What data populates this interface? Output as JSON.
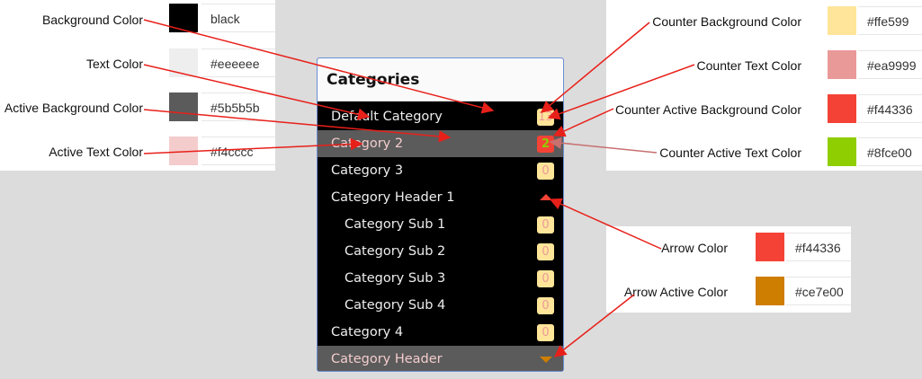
{
  "left_legend": [
    {
      "label": "Background Color",
      "value": "black",
      "swatch": "#000000"
    },
    {
      "label": "Text Color",
      "value": "#eeeeee",
      "swatch": "#eeeeee"
    },
    {
      "label": "Active Background Color",
      "value": "#5b5b5b",
      "swatch": "#5b5b5b"
    },
    {
      "label": "Active Text Color",
      "value": "#f4cccc",
      "swatch": "#f4cccc"
    }
  ],
  "right_legend": [
    {
      "label": "Counter Background Color",
      "value": "#ffe599",
      "swatch": "#ffe599"
    },
    {
      "label": "Counter Text Color",
      "value": "#ea9999",
      "swatch": "#ea9999"
    },
    {
      "label": "Counter Active Background Color",
      "value": "#f44336",
      "swatch": "#f44336"
    },
    {
      "label": "Counter Active Text Color",
      "value": "#8fce00",
      "swatch": "#8fce00"
    }
  ],
  "arrow_legend": [
    {
      "label": "Arrow Color",
      "value": "#f44336",
      "swatch": "#f44336"
    },
    {
      "label": "Arrow Active Color",
      "value": "#ce7e00",
      "swatch": "#ce7e00"
    }
  ],
  "widget": {
    "title": "Categories",
    "items": [
      {
        "label": "Default Category",
        "count": "13"
      },
      {
        "label": "Category 2",
        "count": "2"
      },
      {
        "label": "Category 3",
        "count": "0"
      },
      {
        "label": "Category Header 1"
      },
      {
        "label": "Category Sub 1",
        "count": "0"
      },
      {
        "label": "Category Sub 2",
        "count": "0"
      },
      {
        "label": "Category Sub 3",
        "count": "0"
      },
      {
        "label": "Category Sub 4",
        "count": "0"
      },
      {
        "label": "Category 4",
        "count": "0"
      },
      {
        "label": "Category Header"
      }
    ]
  },
  "colors": {
    "annotation_arrow": "#e8201a",
    "annotation_arrow_muted": "#c87070"
  }
}
